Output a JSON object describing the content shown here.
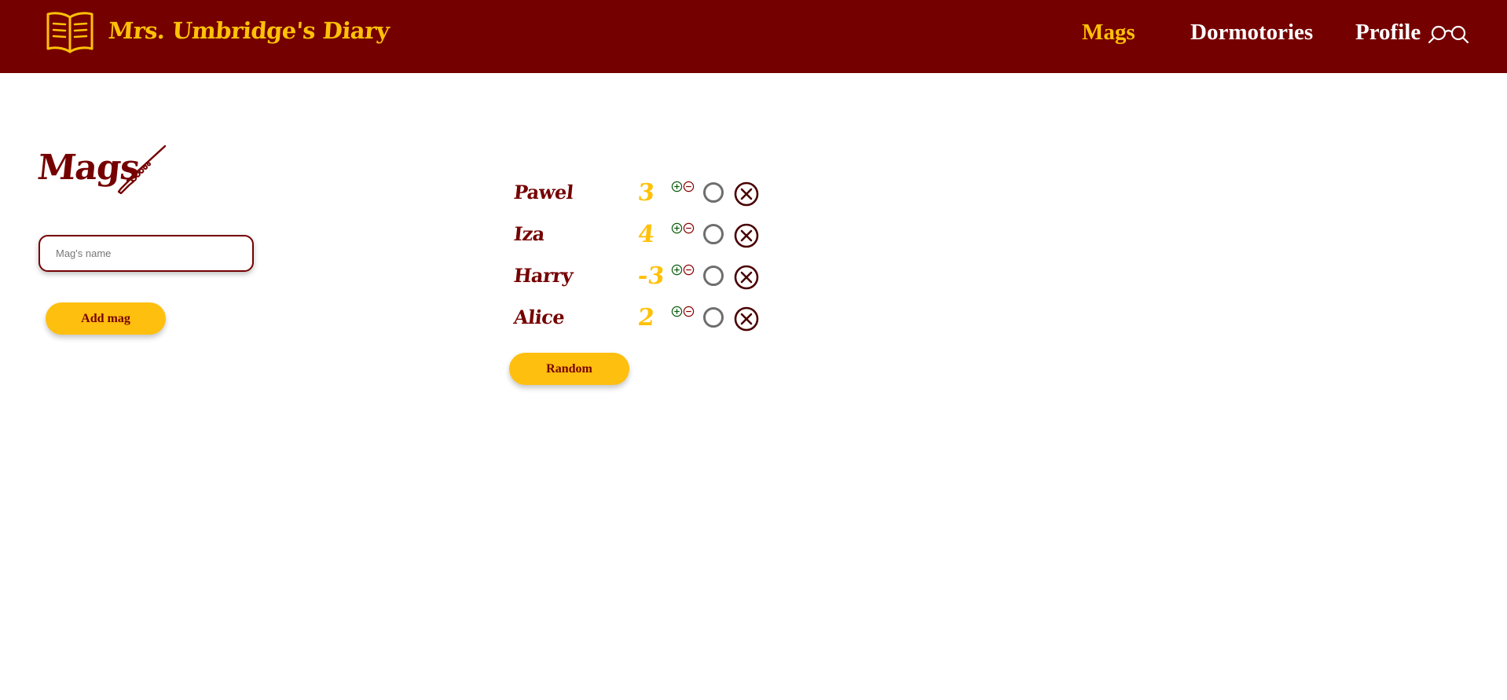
{
  "header": {
    "title": "Mrs. Umbridge's Diary",
    "nav": [
      {
        "label": "Mags",
        "active": true
      },
      {
        "label": "Dormotories",
        "active": false
      },
      {
        "label": "Profile",
        "active": false
      }
    ],
    "colors": {
      "bar": "#750000",
      "accent": "#ffc107",
      "nav_text": "#ffffff"
    },
    "icons": [
      "book-icon",
      "glasses-icon"
    ]
  },
  "main": {
    "title": "Mags",
    "title_icon": "wand-icon",
    "input": {
      "placeholder": "Mag's name",
      "value": ""
    },
    "add_button": "Add mag",
    "mags": [
      {
        "name": "Pawel",
        "score": "3"
      },
      {
        "name": "Iza",
        "score": "4"
      },
      {
        "name": "Harry",
        "score": "-3"
      },
      {
        "name": "Alice",
        "score": "2"
      }
    ],
    "row_icons": [
      "plus-icon",
      "minus-icon",
      "radio-circle",
      "remove-icon"
    ],
    "random_button": "Random"
  }
}
